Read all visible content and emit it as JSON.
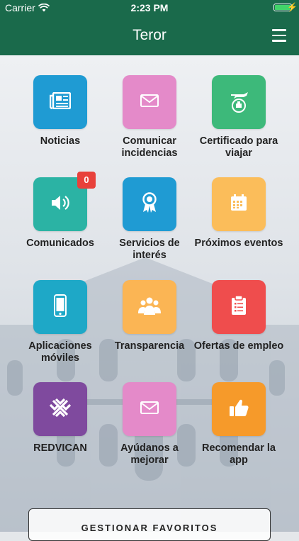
{
  "status": {
    "carrier": "Carrier",
    "time": "2:23 PM"
  },
  "navbar": {
    "title": "Teror"
  },
  "tiles": [
    {
      "label": "Noticias",
      "color": "#1f9bd3",
      "icon": "newspaper-icon"
    },
    {
      "label": "Comunicar incidencias",
      "color": "#e48ac9",
      "icon": "envelope-icon"
    },
    {
      "label": "Certificado para viajar",
      "color": "#3db97a",
      "icon": "travel-certificate-icon"
    },
    {
      "label": "Comunicados",
      "color": "#2bb3a4",
      "icon": "speaker-icon",
      "badge": "0"
    },
    {
      "label": "Servicios de interés",
      "color": "#1f9bd3",
      "icon": "ribbon-icon"
    },
    {
      "label": "Próximos eventos",
      "color": "#fbbd5a",
      "icon": "calendar-icon"
    },
    {
      "label": "Aplicaciones móviles",
      "color": "#1ea8c7",
      "icon": "smartphone-icon"
    },
    {
      "label": "Transparencia",
      "color": "#fbb554",
      "icon": "people-icon"
    },
    {
      "label": "Ofertas de empleo",
      "color": "#ef4d4d",
      "icon": "clipboard-icon"
    },
    {
      "label": "REDVICAN",
      "color": "#7f4a9e",
      "icon": "redvican-logo-icon"
    },
    {
      "label": "Ayúdanos a mejorar",
      "color": "#e48ac9",
      "icon": "envelope-icon"
    },
    {
      "label": "Recomendar la app",
      "color": "#f69a2a",
      "icon": "thumbs-up-icon"
    }
  ],
  "footer": {
    "favorites_label": "GESTIONAR FAVORITOS"
  }
}
